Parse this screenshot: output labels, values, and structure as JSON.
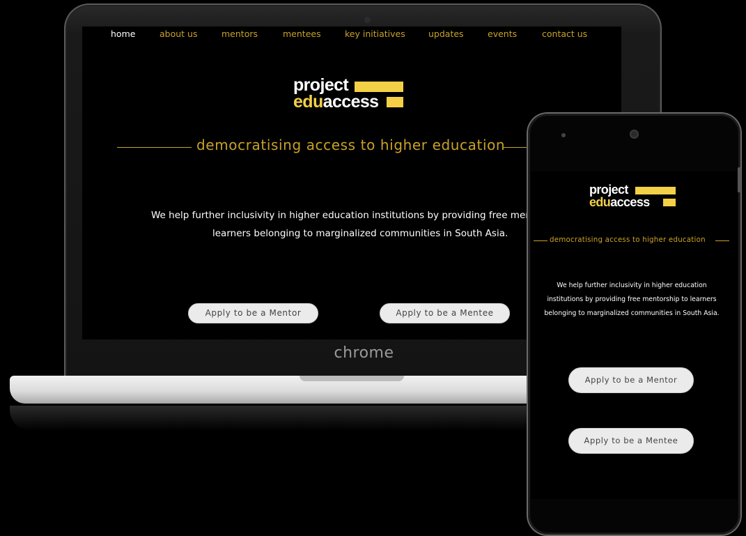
{
  "laptop": {
    "brand_label": "chrome",
    "nav": {
      "items": [
        {
          "label": "home",
          "active": true
        },
        {
          "label": "about us",
          "active": false
        },
        {
          "label": "mentors",
          "active": false
        },
        {
          "label": "mentees",
          "active": false
        },
        {
          "label": "key initiatives",
          "active": false
        },
        {
          "label": "updates",
          "active": false
        },
        {
          "label": "events",
          "active": false
        },
        {
          "label": "contact us",
          "active": false
        }
      ]
    },
    "logo": {
      "line1": "project",
      "line2_a": "edu",
      "line2_b": "access"
    },
    "tagline": "democratising access to higher education",
    "description": {
      "line1": "We help further inclusivity in higher education institutions by providing free mentorsh",
      "line2": "learners belonging to marginalized communities in South Asia."
    },
    "buttons": {
      "mentor": "Apply to be a Mentor",
      "mentee": "Apply to be a Mentee"
    }
  },
  "phone": {
    "logo": {
      "line1": "project",
      "line2_a": "edu",
      "line2_b": "access"
    },
    "tagline": "democratising access to higher education",
    "description": {
      "line1": "We help further inclusivity in higher education",
      "line2": "institutions by providing free mentorship to learners",
      "line3": "belonging to marginalized communities in South Asia."
    },
    "buttons": {
      "mentor": "Apply to be a Mentor",
      "mentee": "Apply to be a Mentee"
    }
  },
  "colors": {
    "accent_gold": "#c9a227",
    "logo_yellow": "#f3d046",
    "background": "#000000",
    "button_bg": "#ebebeb"
  }
}
